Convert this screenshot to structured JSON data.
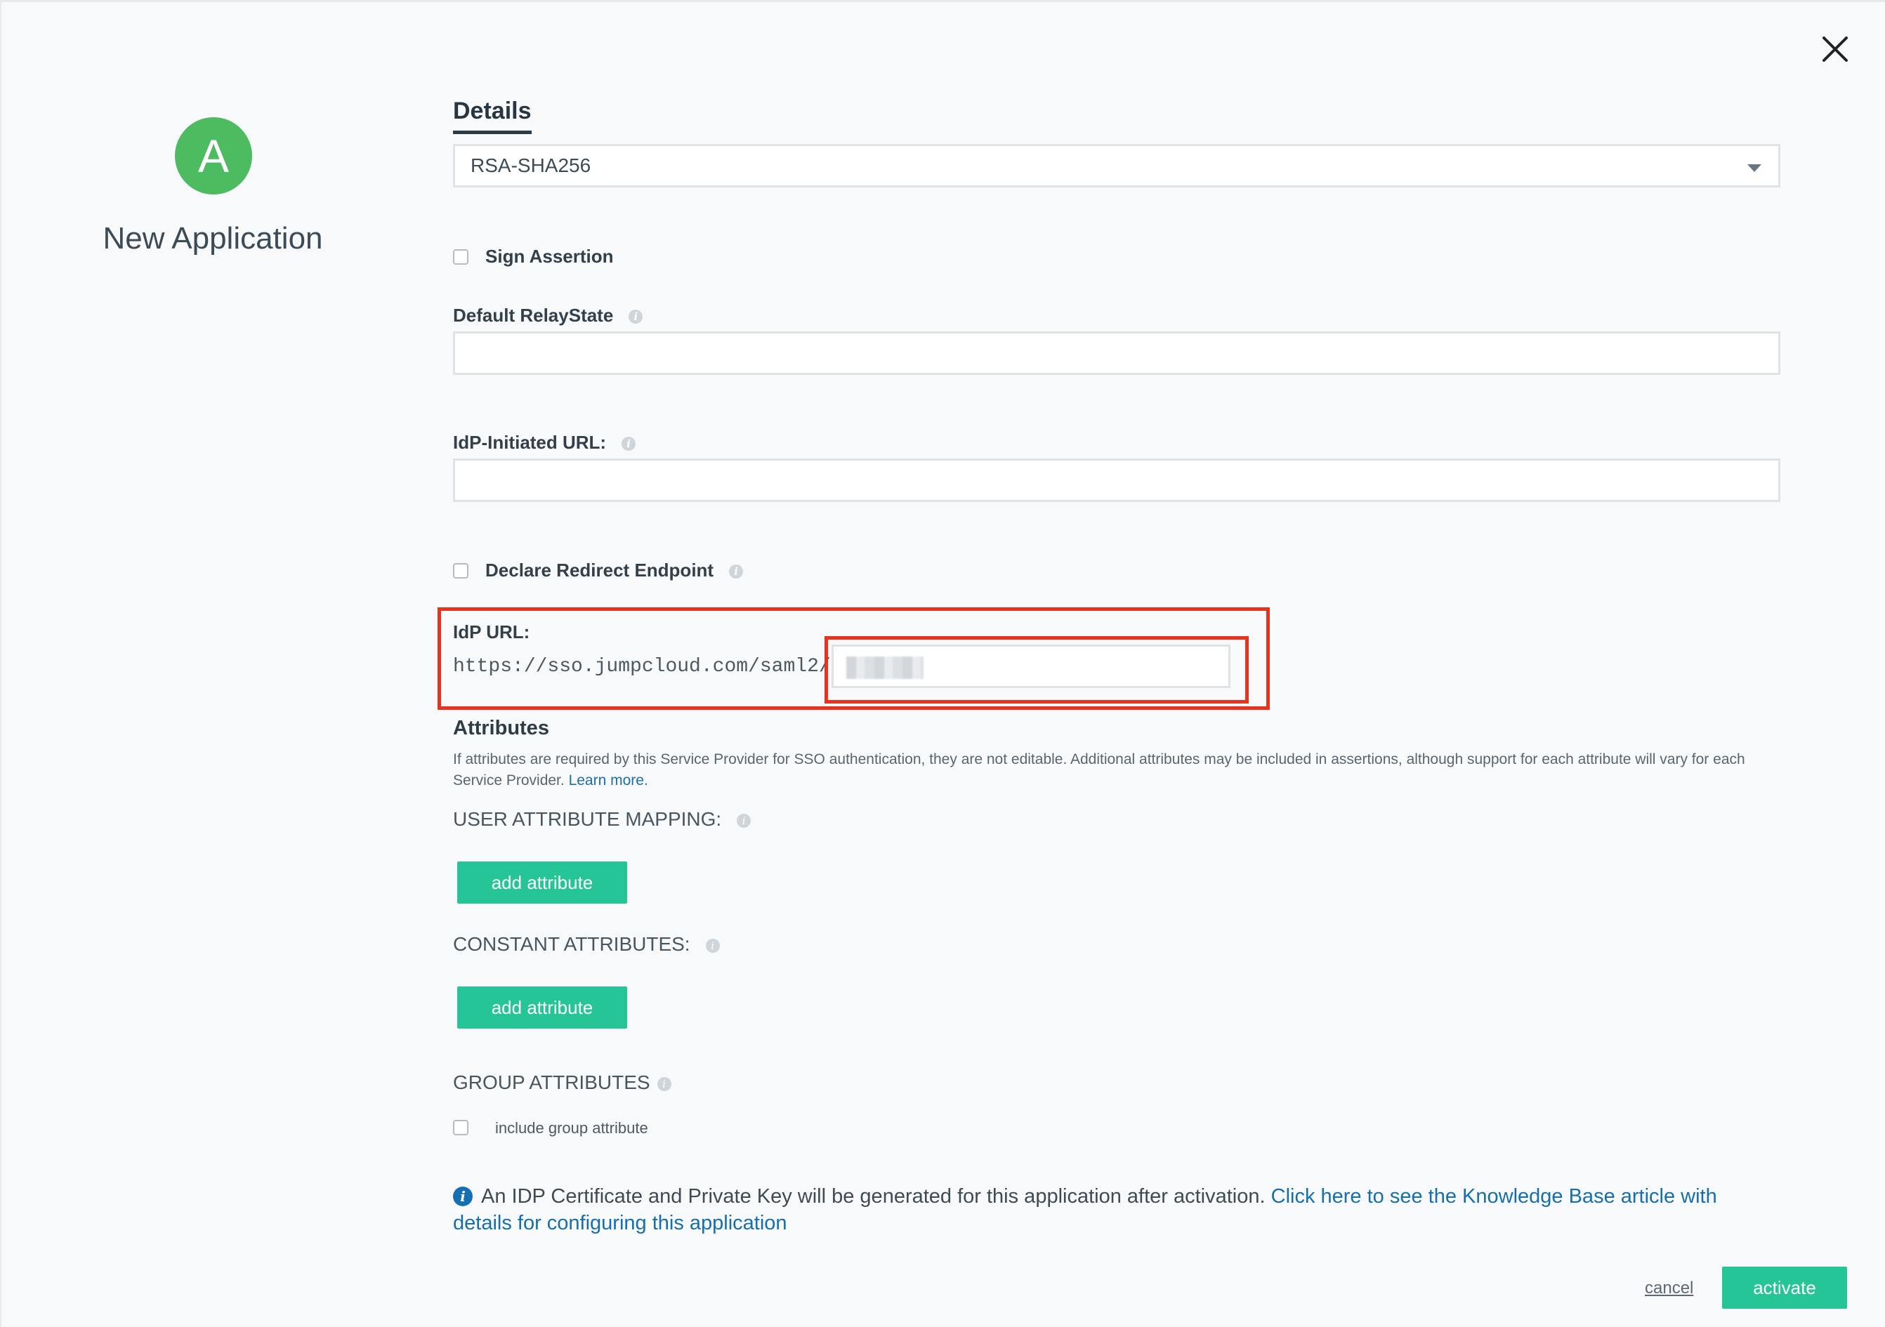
{
  "app": {
    "avatar_letter": "A",
    "title": "New Application"
  },
  "details": {
    "tab_label": "Details",
    "signature_algorithm": "RSA-SHA256",
    "sign_assertion_label": "Sign Assertion",
    "default_relaystate_label": "Default RelayState",
    "default_relaystate_value": "",
    "idp_initiated_url_label": "IdP-Initiated URL:",
    "idp_initiated_url_value": "",
    "declare_redirect_label": "Declare Redirect Endpoint",
    "idp_url_label": "IdP URL:",
    "idp_url_prefix": "https://sso.jumpcloud.com/saml2/",
    "idp_url_suffix_value": ""
  },
  "attributes": {
    "title": "Attributes",
    "description": "If attributes are required by this Service Provider for SSO authentication, they are not editable. Additional attributes may be included in assertions, although support for each attribute will vary for each Service Provider.",
    "learn_more": "Learn more.",
    "user_mapping_label": "USER ATTRIBUTE MAPPING:",
    "constant_label": "CONSTANT ATTRIBUTES:",
    "add_attribute_label": "add attribute",
    "group_label": "GROUP ATTRIBUTES",
    "include_group_label": "include group attribute"
  },
  "info_note": {
    "text": "An IDP Certificate and Private Key will be generated for this application after activation.",
    "link": "Click here to see the Knowledge Base article with details for configuring this application"
  },
  "footer": {
    "cancel_label": "cancel",
    "activate_label": "activate"
  },
  "icons": {
    "info": "i",
    "close": "close-icon"
  },
  "colors": {
    "accent_green": "#26c597",
    "avatar_green": "#4dbb5f",
    "highlight_red": "#e8321e",
    "link_blue": "#1f6fa3"
  }
}
